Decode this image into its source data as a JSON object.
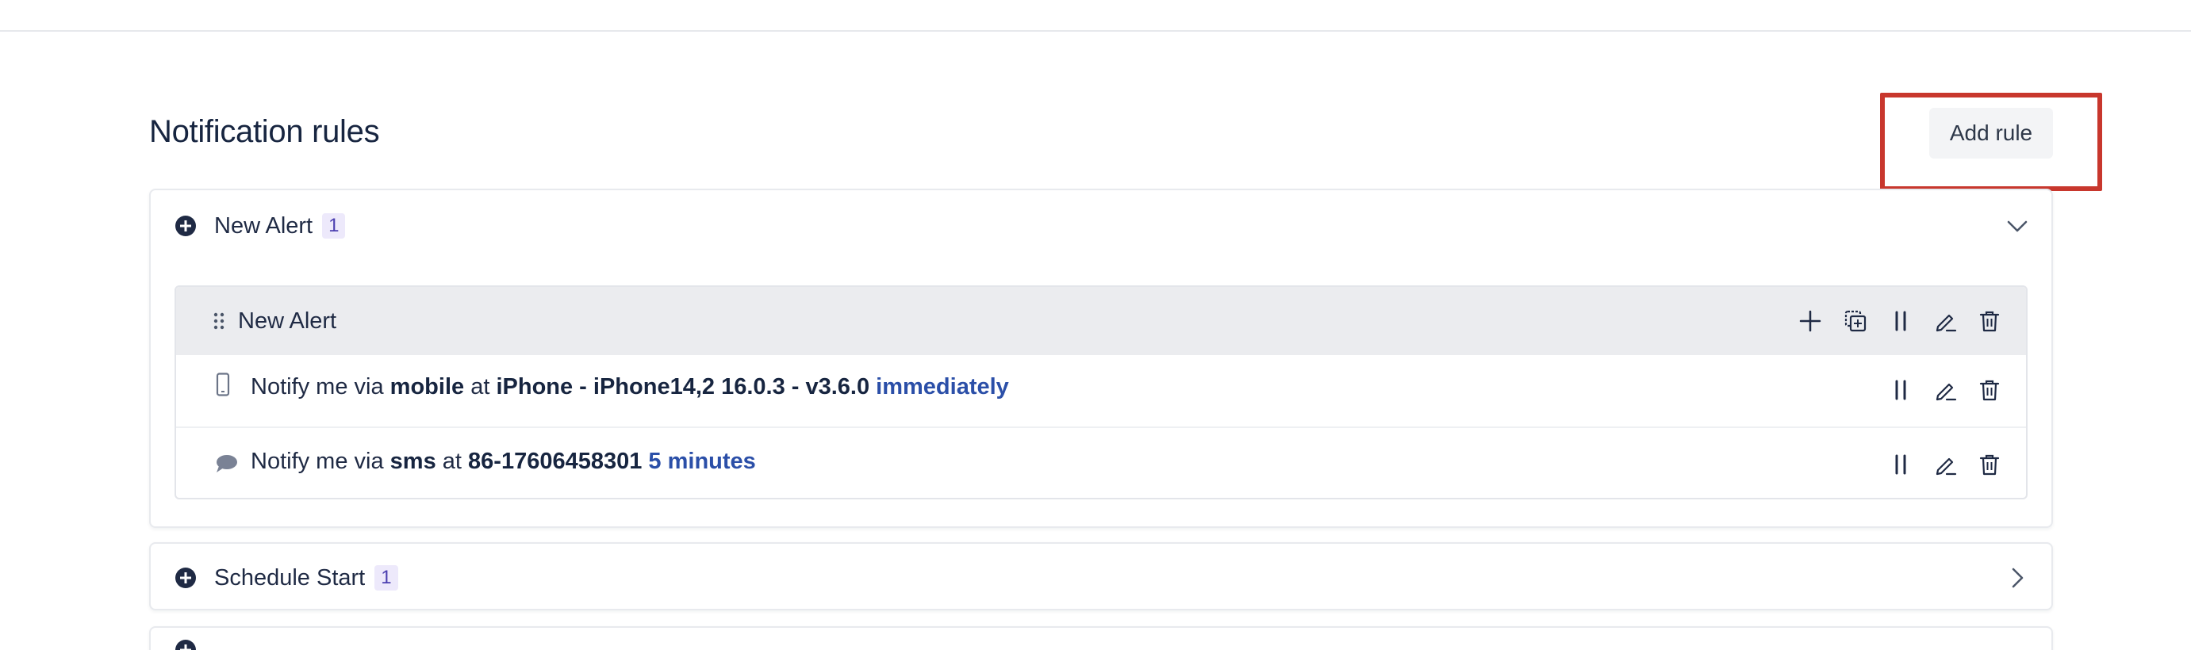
{
  "page": {
    "title": "Notification rules",
    "add_rule_label": "Add rule"
  },
  "colors": {
    "accent_blue": "#2b4fa8",
    "highlight_red": "#c8372d",
    "badge_bg": "#ede9fb",
    "badge_text": "#4b3fb0"
  },
  "cards": [
    {
      "title": "New Alert",
      "count": "1",
      "expanded": true,
      "icon": "plus-circle-icon",
      "group": {
        "title": "New Alert",
        "actions": [
          "add-icon",
          "duplicate-icon",
          "pause-icon",
          "edit-icon",
          "delete-icon"
        ],
        "rules": [
          {
            "icon": "mobile-phone-icon",
            "prefix": "Notify me via",
            "method": "mobile",
            "connector": "at",
            "target": "iPhone - iPhone14,2 16.0.3 - v3.6.0",
            "timing": "immediately"
          },
          {
            "icon": "chat-bubble-icon",
            "prefix": "Notify me via",
            "method": "sms",
            "connector": "at",
            "target": "86-17606458301",
            "timing": "5 minutes"
          }
        ]
      }
    },
    {
      "title": "Schedule Start",
      "count": "1",
      "expanded": false,
      "icon": "plus-circle-icon"
    }
  ]
}
